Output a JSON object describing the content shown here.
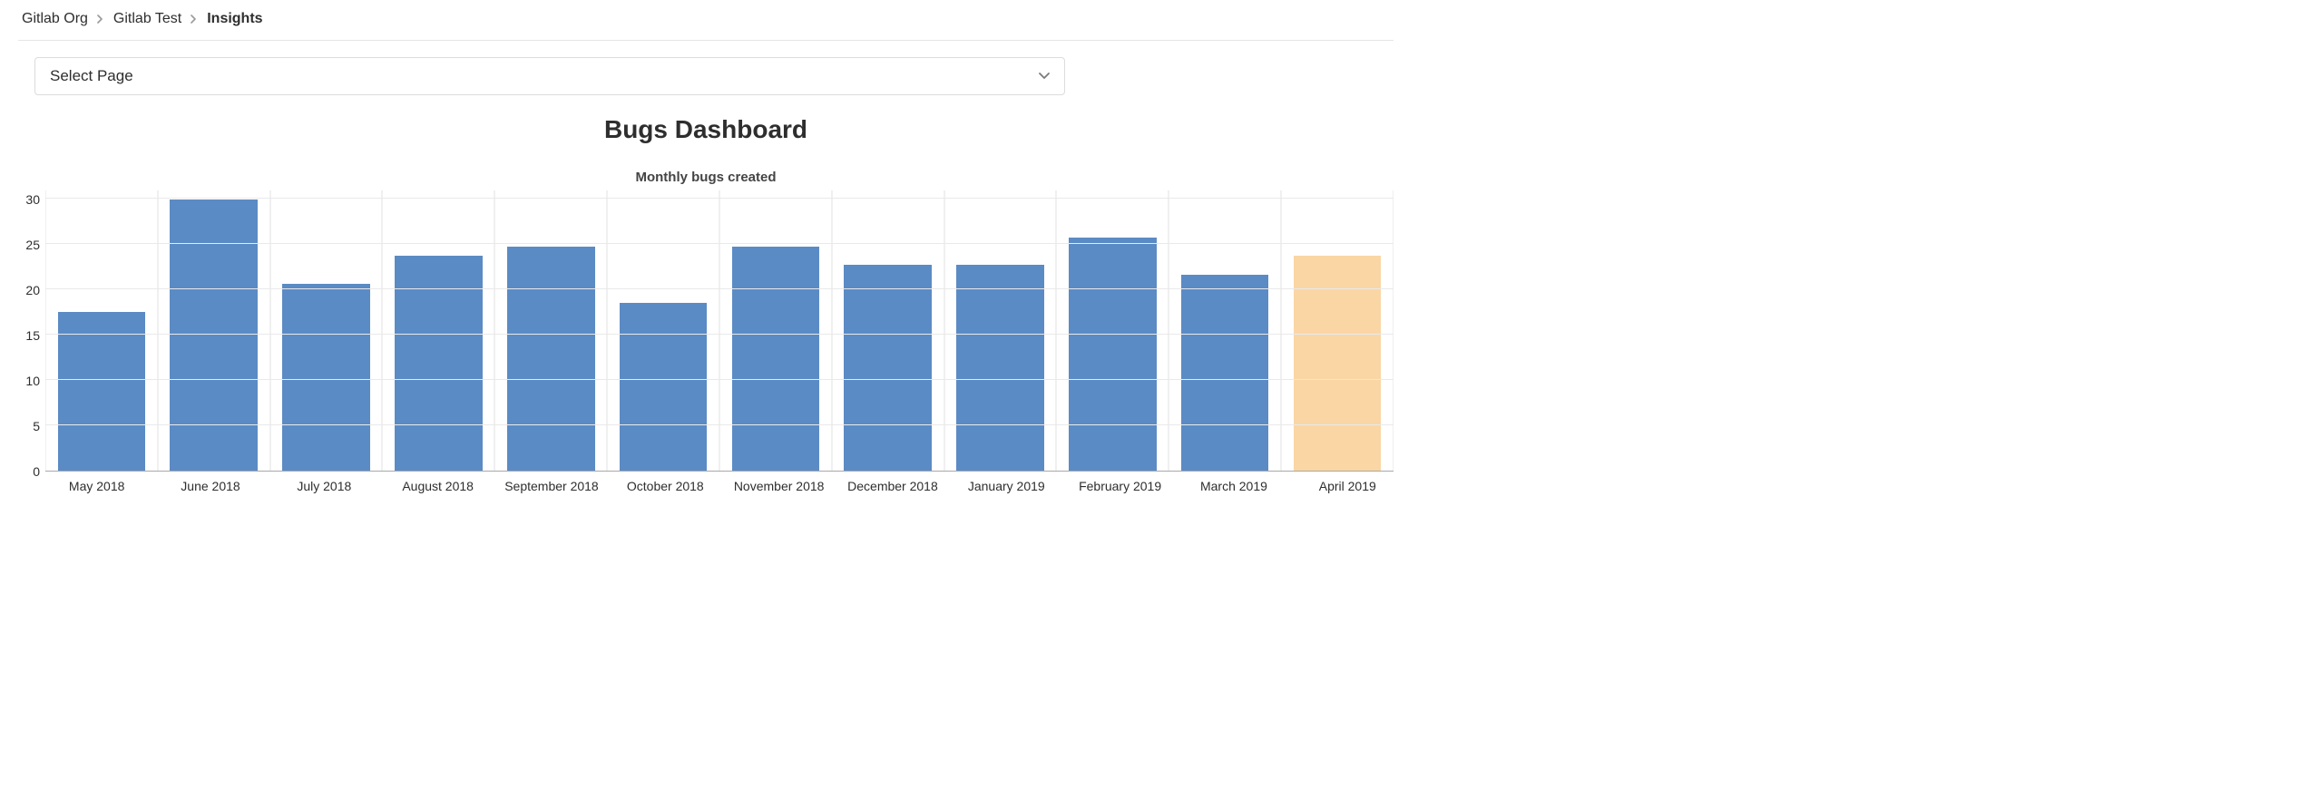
{
  "breadcrumb": {
    "items": [
      {
        "label": "Gitlab Org"
      },
      {
        "label": "Gitlab Test"
      },
      {
        "label": "Insights"
      }
    ]
  },
  "select": {
    "label": "Select Page"
  },
  "page_title": "Bugs Dashboard",
  "chart_data": {
    "type": "bar",
    "title": "Monthly bugs created",
    "xlabel": "",
    "ylabel": "",
    "ylim": [
      0,
      30
    ],
    "yticks": [
      0,
      5,
      10,
      15,
      20,
      25,
      30
    ],
    "categories": [
      "May 2018",
      "June 2018",
      "July 2018",
      "August 2018",
      "September 2018",
      "October 2018",
      "November 2018",
      "December 2018",
      "January 2019",
      "February 2019",
      "March 2019",
      "April 2019"
    ],
    "values": [
      17,
      29,
      20,
      23,
      24,
      18,
      24,
      22,
      22,
      25,
      21,
      23
    ],
    "colors": {
      "default": "#5b8bc4",
      "highlight": "#fad6a5"
    },
    "highlight_index": 11
  }
}
